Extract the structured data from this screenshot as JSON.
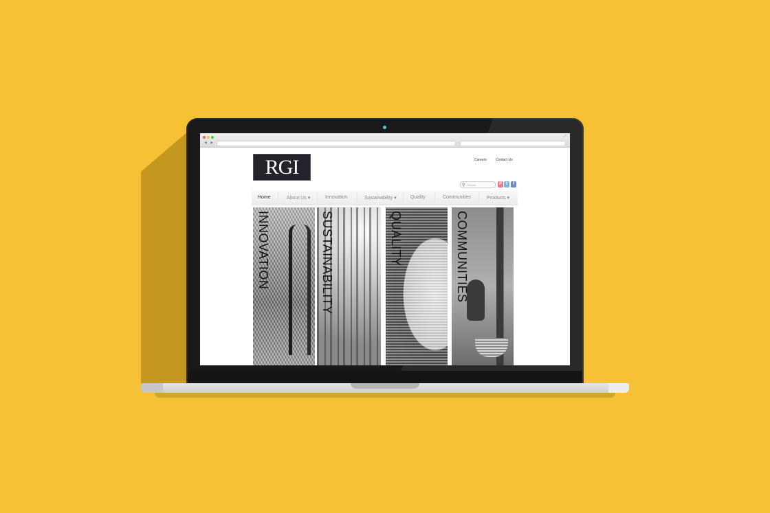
{
  "browser": {
    "nav_arrows": "◀ ▶"
  },
  "site": {
    "logo_text": "RGI",
    "top_links": {
      "careers": "Careers",
      "contact": "Contact Us"
    },
    "search": {
      "placeholder": "Search"
    },
    "social": {
      "pinterest": "P",
      "twitter": "t",
      "facebook": "f"
    },
    "menu": {
      "home": "Home",
      "about": "About Us ▾",
      "innovation": "Innovation",
      "sustainability": "Sustainability ▾",
      "quality": "Quality",
      "communities": "Communities",
      "products": "Products ▾"
    },
    "panels": {
      "innovation": "INNOVATION",
      "sustainability": "SUSTAINABILITY",
      "quality": "QUALITY",
      "communities": "COMMUNITIES"
    }
  },
  "colors": {
    "background": "#F7C135",
    "laptop_body": "#191919",
    "logo_bg": "#23232b"
  },
  "icons": {
    "search": "search-icon",
    "pinterest": "pinterest-icon",
    "twitter": "twitter-icon",
    "facebook": "facebook-icon"
  }
}
